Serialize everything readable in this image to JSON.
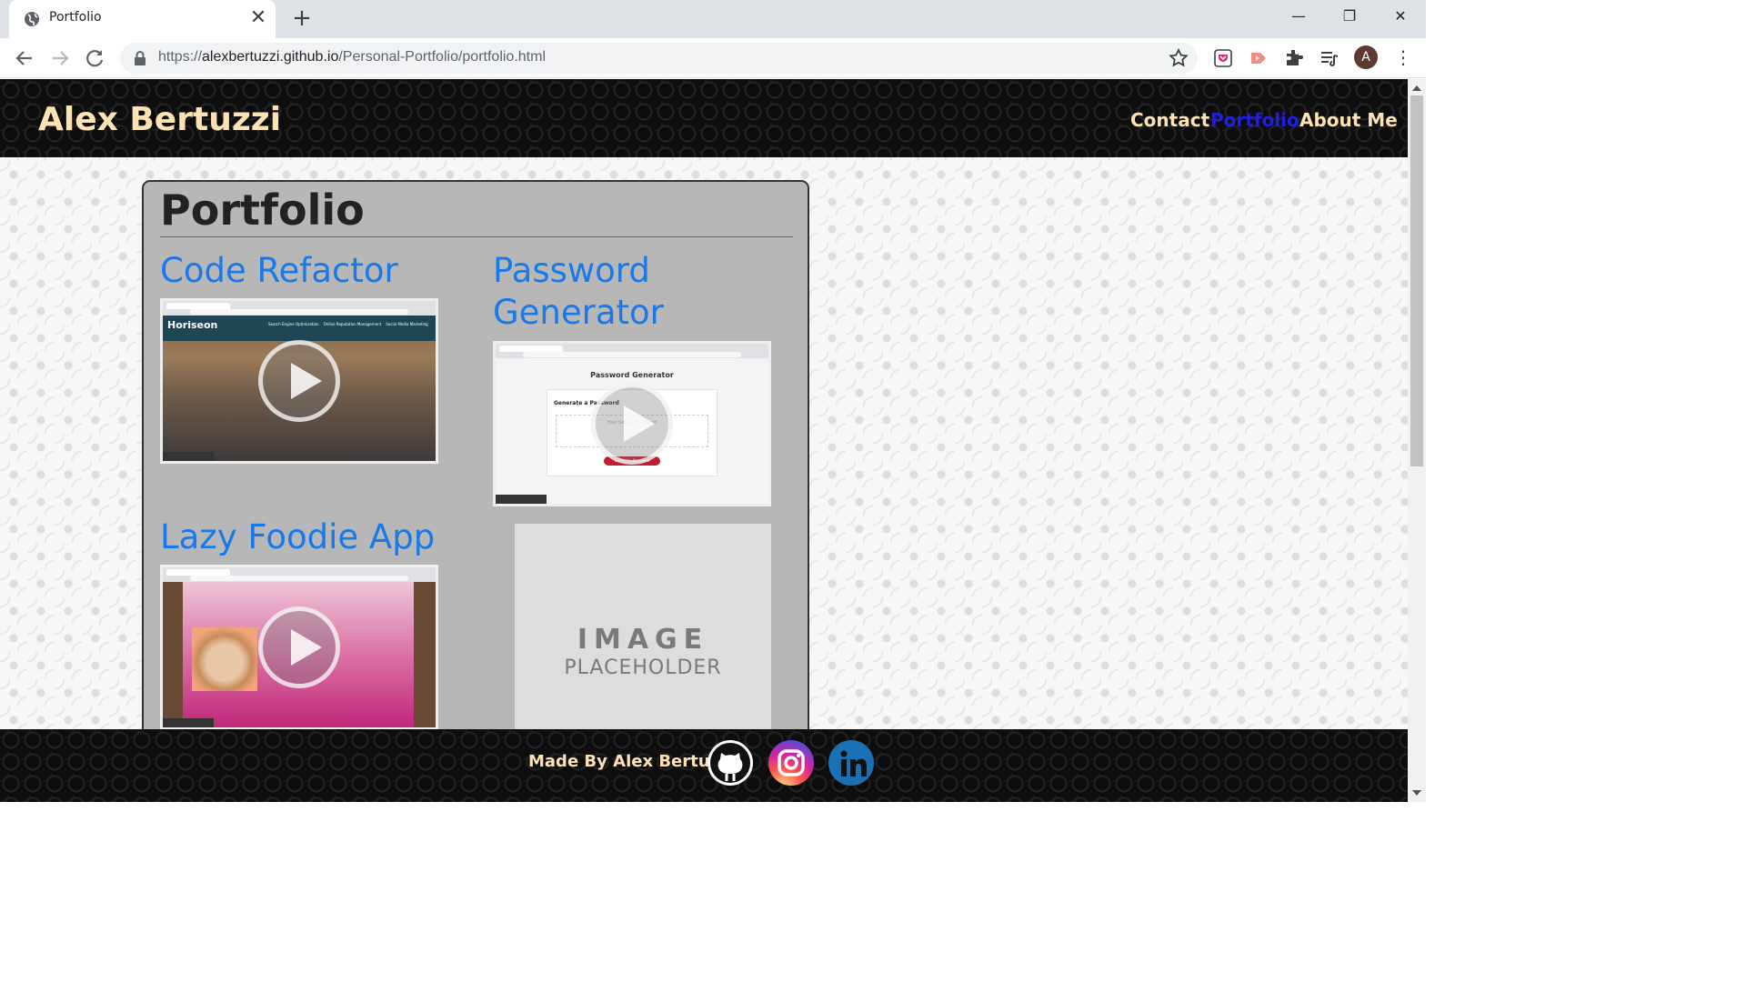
{
  "browser": {
    "tab_title": "Portfolio",
    "tab_close": "✕",
    "new_tab": "+",
    "url_scheme": "https://",
    "url_host": "alexbertuzzi.github.io",
    "url_path": "/Personal-Portfolio/portfolio.html",
    "avatar_initial": "A",
    "minimize": "—",
    "maximize": "❐",
    "close": "✕",
    "menu": "⋮",
    "icons": [
      "back-icon",
      "forward-icon",
      "reload-icon",
      "lock-icon",
      "star-icon",
      "pocket-icon",
      "cast-icon",
      "extensions-icon",
      "reading-list-icon"
    ]
  },
  "site": {
    "title": "Alex Bertuzzi",
    "nav": [
      {
        "label": "Contact",
        "active": false
      },
      {
        "label": "Portfolio",
        "active": true
      },
      {
        "label": "About Me",
        "active": false
      }
    ],
    "nav_active_color": "#1f1fe0",
    "brand_color": "#fde2b4"
  },
  "portfolio": {
    "heading": "Portfolio",
    "projects": [
      {
        "title": "Code Refactor",
        "thumb_site": "Horiseon",
        "thumb_nav": "Search Engine Optimization    Online Reputation Management    Social Media Marketing"
      },
      {
        "title_line1": "Password",
        "title_line2": "Generator",
        "thumb_heading": "Password Generator",
        "thumb_label": "Generate a Password",
        "thumb_input": "Your Secure Password",
        "thumb_button": "Generate Password"
      },
      {
        "title": "Lazy Foodie App"
      }
    ],
    "placeholder_line1": "IMAGE",
    "placeholder_line2": "PLACEHOLDER",
    "link_color": "#1779ea"
  },
  "footer": {
    "text": "Made By Alex Bertuzzi",
    "social": [
      "github-icon",
      "instagram-icon",
      "linkedin-icon"
    ]
  }
}
